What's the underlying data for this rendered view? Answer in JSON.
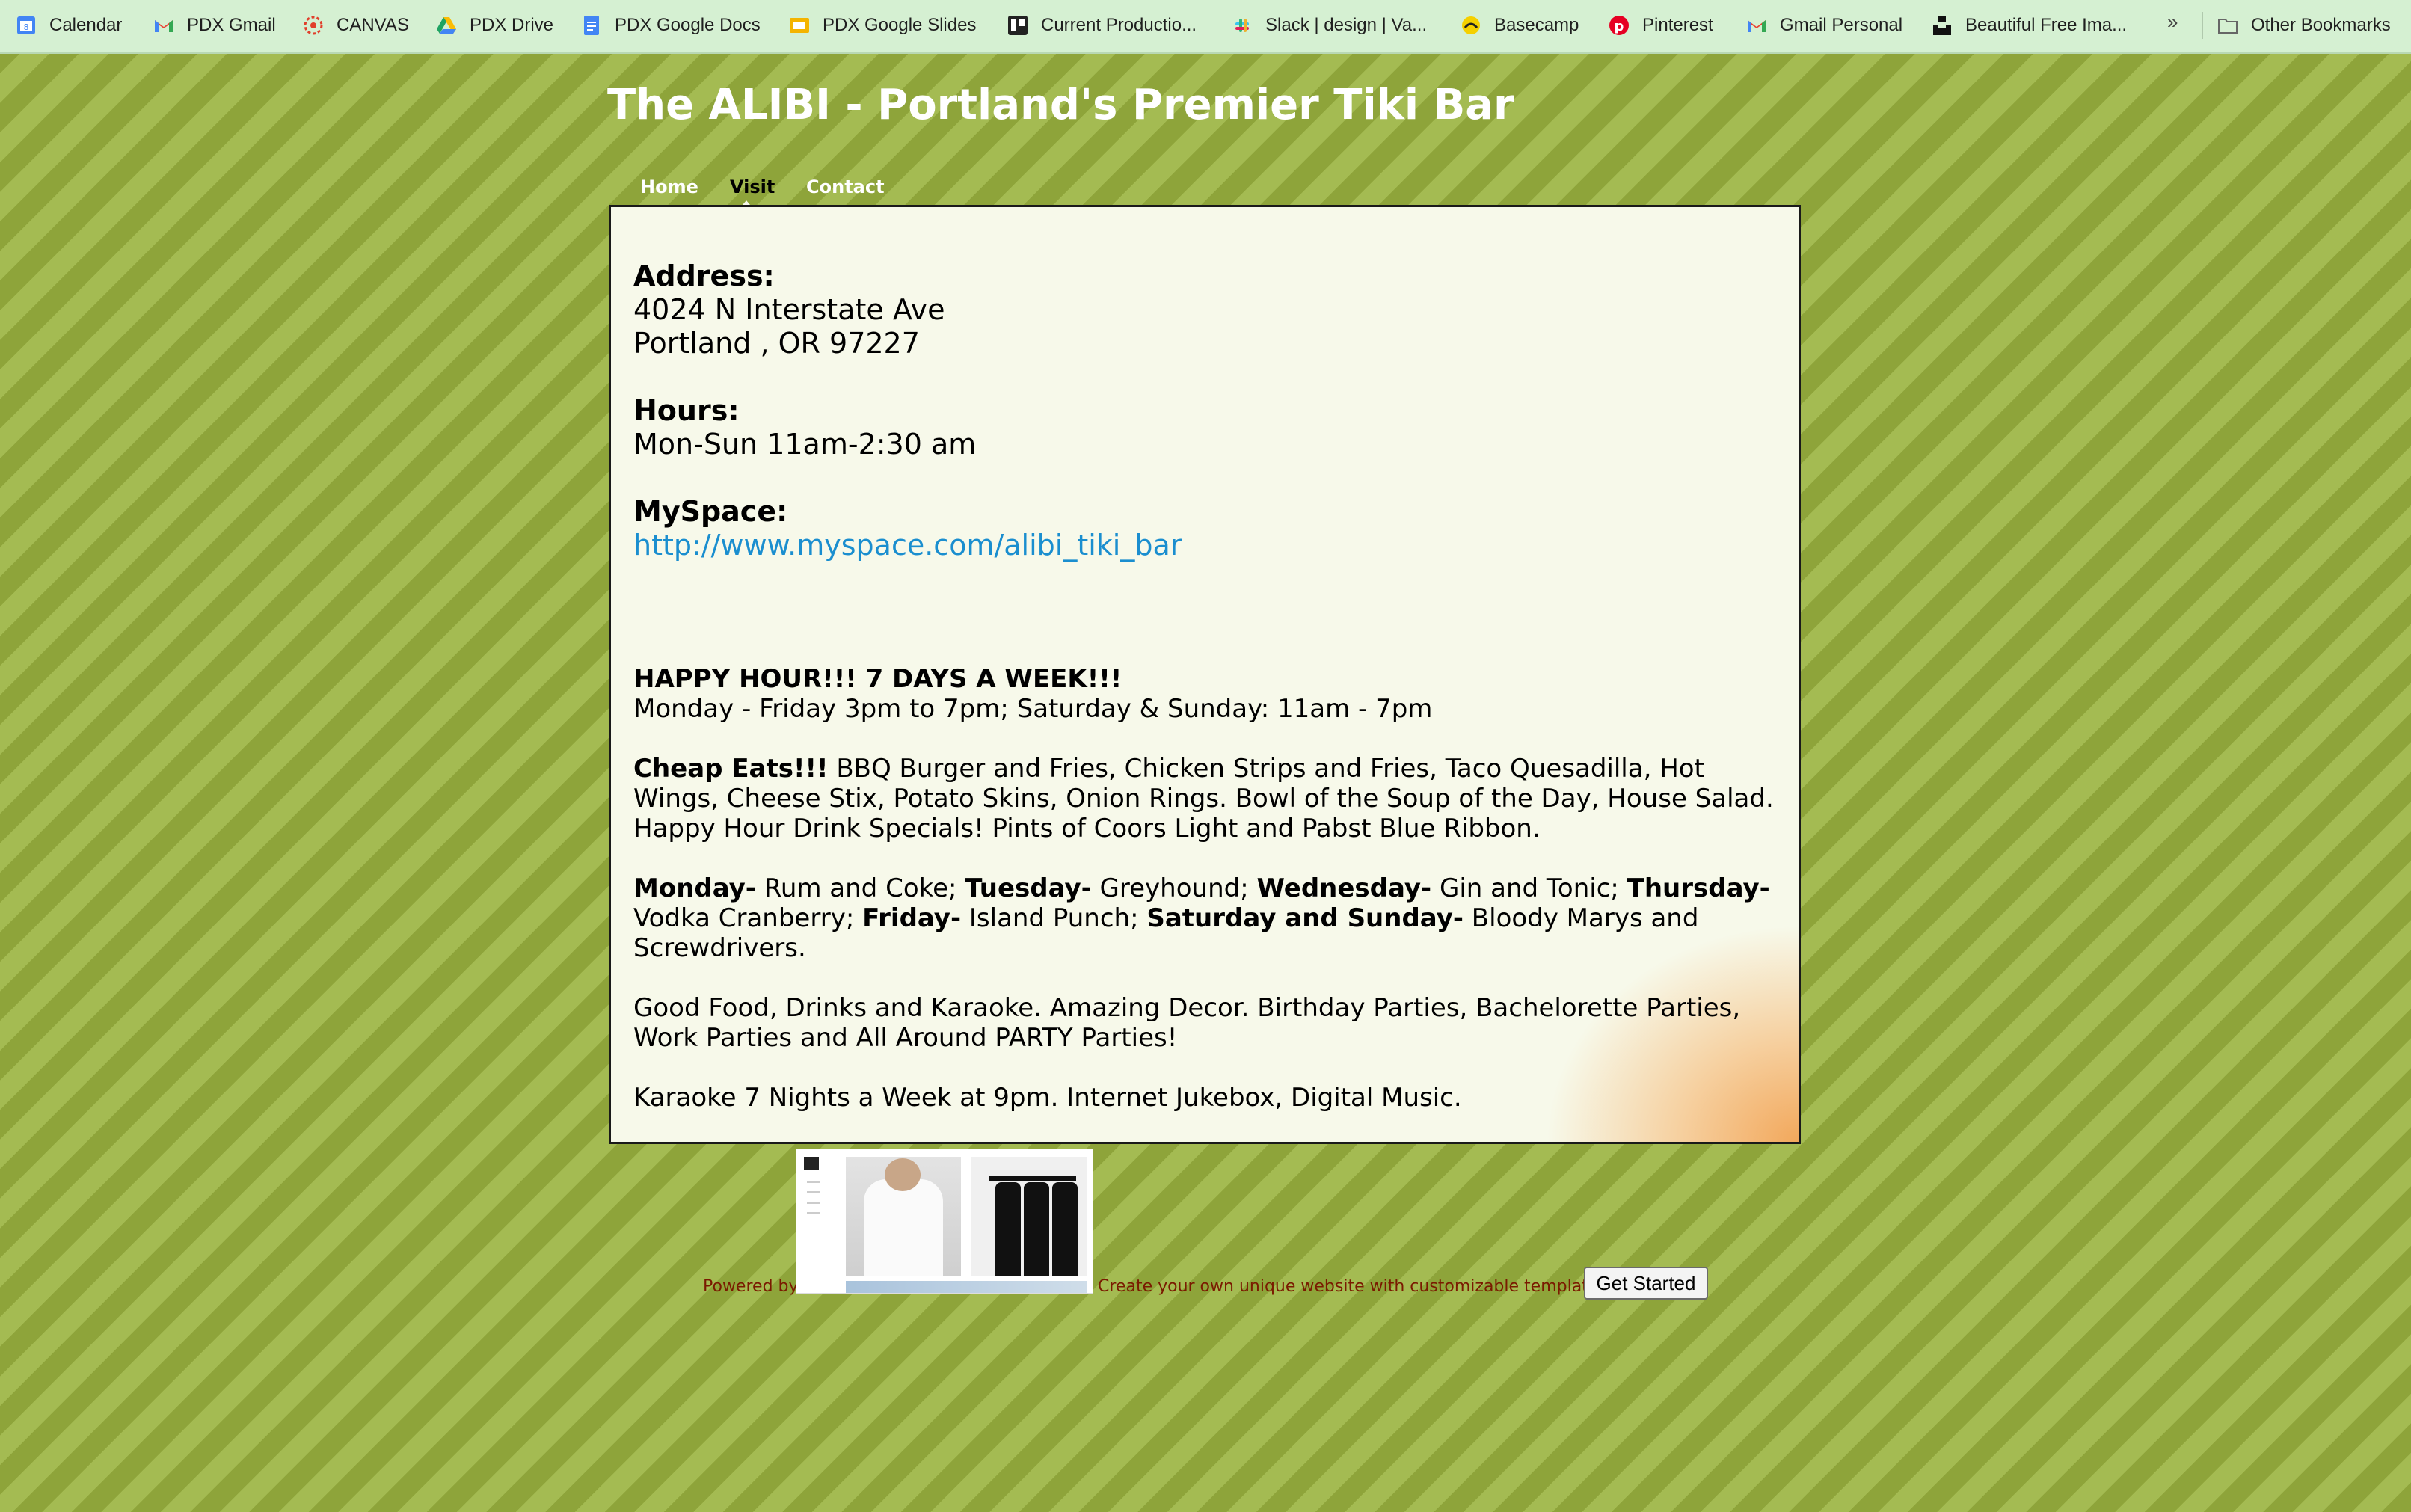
{
  "bookmarks": {
    "items": [
      {
        "label": "Calendar",
        "icon": "google-calendar-icon",
        "color": "#4285f4"
      },
      {
        "label": "PDX Gmail",
        "icon": "gmail-icon",
        "color": "#ea4335"
      },
      {
        "label": "CANVAS",
        "icon": "canvas-icon",
        "color": "#e13f2b"
      },
      {
        "label": "PDX Drive",
        "icon": "google-drive-icon",
        "color": "#1fa463"
      },
      {
        "label": "PDX Google Docs",
        "icon": "google-docs-icon",
        "color": "#4285f4"
      },
      {
        "label": "PDX Google Slides",
        "icon": "google-slides-icon",
        "color": "#f4b400"
      },
      {
        "label": "Current Productio...",
        "icon": "trello-icon",
        "color": "#222222"
      },
      {
        "label": "Slack | design | Va...",
        "icon": "slack-icon",
        "color": "#e01e5a"
      },
      {
        "label": "Basecamp",
        "icon": "basecamp-icon",
        "color": "#f5d000"
      },
      {
        "label": "Pinterest",
        "icon": "pinterest-icon",
        "color": "#e60023"
      },
      {
        "label": "Gmail Personal",
        "icon": "gmail-icon",
        "color": "#ea4335"
      },
      {
        "label": "Beautiful Free Ima...",
        "icon": "unsplash-icon",
        "color": "#111111"
      }
    ],
    "more": "»",
    "other": "Other Bookmarks"
  },
  "site": {
    "title": "The ALIBI - Portland's Premier Tiki Bar"
  },
  "nav": {
    "items": [
      "Home",
      "Visit",
      "Contact"
    ],
    "active": "Visit"
  },
  "content": {
    "address_label": "Address:",
    "address_line1": "4024 N Interstate Ave",
    "address_line2": "Portland , OR 97227",
    "hours_label": "Hours:",
    "hours": "Mon-Sun 11am-2:30 am",
    "myspace_label": "MySpace:",
    "myspace_url": "http://www.myspace.com/alibi_tiki_bar",
    "happy_hour_title": "HAPPY HOUR!!! 7 DAYS A WEEK!!!",
    "happy_hour_times": "Monday - Friday 3pm to 7pm; Saturday & Sunday: 11am - 7pm",
    "cheap_eats_label": "Cheap Eats!!!",
    "cheap_eats_text": " BBQ Burger and Fries, Chicken Strips and Fries, Taco Quesadilla, Hot Wings, Cheese Stix, Potato Skins, Onion Rings. Bowl of the Soup of the Day, House Salad. Happy Hour Drink Specials! Pints of Coors Light and Pabst Blue Ribbon.",
    "specials": [
      {
        "day": "Monday-",
        "drink": " Rum and Coke; "
      },
      {
        "day": "Tuesday-",
        "drink": " Greyhound; "
      },
      {
        "day": "Wednesday-",
        "drink": " Gin and Tonic; "
      },
      {
        "day": "Thursday-",
        "drink": " Vodka Cranberry; "
      },
      {
        "day": "Friday-",
        "drink": " Island Punch; "
      },
      {
        "day": "Saturday and Sunday-",
        "drink": " Bloody Marys and Screwdrivers."
      }
    ],
    "good_food": "Good Food, Drinks and Karaoke. Amazing Decor. Birthday Parties, Bachelorette Parties, Work Parties and All Around PARTY Parties!",
    "karaoke": "Karaoke 7 Nights a Week at 9pm. Internet Jukebox, Digital Music."
  },
  "footer": {
    "powered_by": "Powered by",
    "cta_text": "Create your own unique website with customizable templates.",
    "button": "Get Started"
  }
}
